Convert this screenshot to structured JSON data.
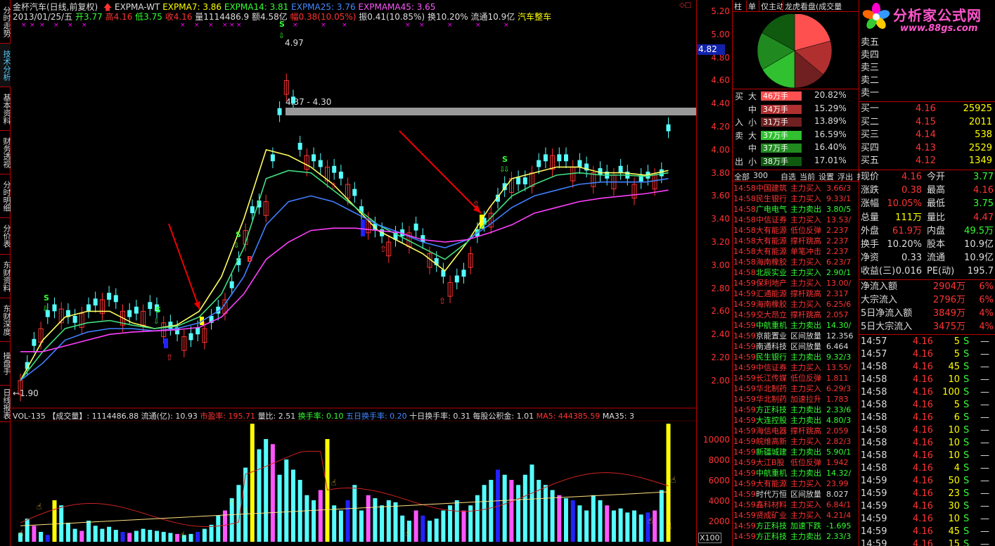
{
  "left_tabs": [
    "分时走势",
    "技术分析",
    "基本资料",
    "财务透视",
    "分时明细",
    "分价表",
    "东财资料",
    "东财深度",
    "操盘手",
    "日线报表"
  ],
  "header": {
    "title": "金杯汽车(日线,前复权)",
    "indicator_name": "EXPMA-WT",
    "expma7": "EXPMA7: 3.86",
    "expma14": "EXPMA14: 3.81",
    "expma25": "EXPMA25: 3.76",
    "expmama45": "EXPMAMA45: 3.65",
    "date": "2013/01/25/五",
    "open": "开3.77",
    "high": "高4.16",
    "low": "低3.75",
    "close": "收4.16",
    "vol": "量1114486.9",
    "amount": "额4.58亿",
    "change": "幅0.38(10.05%)",
    "amplitude": "振0.41(10.85%)",
    "turnover": "换10.20%",
    "float": "流通10.9亿",
    "sector": "汽车整车"
  },
  "price_axis": [
    "5.20",
    "5.00",
    "4.80",
    "4.60",
    "4.40",
    "4.20",
    "4.00",
    "3.80",
    "3.60",
    "3.40",
    "3.20",
    "3.00",
    "2.80",
    "2.60",
    "2.40",
    "2.20",
    "2.00"
  ],
  "price_marker": "4.82",
  "vol_axis": [
    "10000",
    "8000",
    "6000",
    "4000",
    "2000"
  ],
  "vol_unit": "X100",
  "annotations": {
    "high": "4.97",
    "range": "4.37 - 4.30",
    "low": "1.90"
  },
  "vol_header": {
    "name": "VOL-135",
    "label": "【成交量】: 1114486.88",
    "float": "流通(亿): 10.93",
    "pe": "市盈率: 195.71",
    "vr": "量比: 2.51",
    "turn": "换手率: 0.10",
    "turn5": "五日换手率: 0.20",
    "turn10": "十日换手率: 0.31",
    "fund": "每股公积金: 1.01",
    "ma5": "MA5: 444385.59",
    "ma35": "MA35: 3"
  },
  "mid_tabs": [
    "柱",
    "单",
    "仅主动",
    "龙虎看盘(成交量"
  ],
  "flow": {
    "side_labels": [
      "买",
      "入",
      "卖",
      "出"
    ],
    "rows": [
      {
        "size": "大",
        "amt": "46万手",
        "pct": "20.82%",
        "color": "#ff5050"
      },
      {
        "size": "中",
        "amt": "34万手",
        "pct": "15.29%",
        "color": "#b03030"
      },
      {
        "size": "小",
        "amt": "31万手",
        "pct": "13.89%",
        "color": "#702020"
      },
      {
        "size": "大",
        "amt": "37万手",
        "pct": "16.59%",
        "color": "#30c030"
      },
      {
        "size": "中",
        "amt": "37万手",
        "pct": "16.40%",
        "color": "#208a20"
      },
      {
        "size": "小",
        "amt": "38万手",
        "pct": "17.01%",
        "color": "#105a10"
      }
    ]
  },
  "filter_tabs": [
    "全部",
    "300",
    "自选",
    "当前",
    "设置",
    "浮出",
    "扌"
  ],
  "trades": [
    {
      "t": "14:58",
      "n": "中国建筑",
      "a": "主力买入",
      "v": "3.66/3",
      "cls": "r"
    },
    {
      "t": "14:58",
      "n": "民生银行",
      "a": "主力买入",
      "v": "9.33/1",
      "cls": "r"
    },
    {
      "t": "14:58",
      "n": "广电电气",
      "a": "主力卖出",
      "v": "3.80/5",
      "cls": "g"
    },
    {
      "t": "14:58",
      "n": "中信证券",
      "a": "主力买入",
      "v": "13.53/",
      "cls": "r"
    },
    {
      "t": "14:58",
      "n": "大有能源",
      "a": "低位反弹",
      "v": "2.237",
      "cls": "r"
    },
    {
      "t": "14:58",
      "n": "大有能源",
      "a": "撑杆跳高",
      "v": "2.237",
      "cls": "r"
    },
    {
      "t": "14:58",
      "n": "大有能源",
      "a": "单笔冲击",
      "v": "2.237",
      "cls": "r"
    },
    {
      "t": "14:58",
      "n": "海南橡胶",
      "a": "主力买入",
      "v": "6.23/7",
      "cls": "r"
    },
    {
      "t": "14:58",
      "n": "北辰实业",
      "a": "主力买入",
      "v": "2.90/1",
      "cls": "g"
    },
    {
      "t": "14:59",
      "n": "保利地产",
      "a": "主力买入",
      "v": "13.00/",
      "cls": "r"
    },
    {
      "t": "14:59",
      "n": "汇通能源",
      "a": "撑杆跳高",
      "v": "2.317",
      "cls": "r"
    },
    {
      "t": "14:59",
      "n": "海南橡胶",
      "a": "主力买入",
      "v": "6.25/6",
      "cls": "r"
    },
    {
      "t": "14:59",
      "n": "交大昂立",
      "a": "撑杆跳高",
      "v": "2.057",
      "cls": "r"
    },
    {
      "t": "14:59",
      "n": "中航重机",
      "a": "主力卖出",
      "v": "14.30/",
      "cls": "g"
    },
    {
      "t": "14:59",
      "n": "京能置业",
      "a": "区间放量",
      "v": "12.356",
      "cls": "w"
    },
    {
      "t": "14:59",
      "n": "南通科技",
      "a": "区间放量",
      "v": "6.464",
      "cls": "w"
    },
    {
      "t": "14:59",
      "n": "民生银行",
      "a": "主力卖出",
      "v": "9.32/3",
      "cls": "g"
    },
    {
      "t": "14:59",
      "n": "中信证券",
      "a": "主力买入",
      "v": "13.55/",
      "cls": "r"
    },
    {
      "t": "14:59",
      "n": "长江传媒",
      "a": "低位反弹",
      "v": "1.811",
      "cls": "r"
    },
    {
      "t": "14:59",
      "n": "华北制药",
      "a": "主力买入",
      "v": "6.29/3",
      "cls": "r"
    },
    {
      "t": "14:59",
      "n": "华北制药",
      "a": "加速拉升",
      "v": "1.783",
      "cls": "r"
    },
    {
      "t": "14:59",
      "n": "方正科技",
      "a": "主力卖出",
      "v": "2.33/6",
      "cls": "g"
    },
    {
      "t": "14:59",
      "n": "大连控股",
      "a": "主力卖出",
      "v": "4.80/3",
      "cls": "g"
    },
    {
      "t": "14:59",
      "n": "海信电器",
      "a": "撑杆跳高",
      "v": "2.059",
      "cls": "r"
    },
    {
      "t": "14:59",
      "n": "皖维高新",
      "a": "主力买入",
      "v": "2.82/3",
      "cls": "r"
    },
    {
      "t": "14:59",
      "n": "新疆城建",
      "a": "主力卖出",
      "v": "5.90/1",
      "cls": "g"
    },
    {
      "t": "14:59",
      "n": "大江B股",
      "a": "低位反弹",
      "v": "1.942",
      "cls": "r"
    },
    {
      "t": "14:59",
      "n": "中航重机",
      "a": "主力卖出",
      "v": "14.32/",
      "cls": "g"
    },
    {
      "t": "14:59",
      "n": "大有能源",
      "a": "主力买入",
      "v": "23.99",
      "cls": "r"
    },
    {
      "t": "14:59",
      "n": "时代万恒",
      "a": "区间放量",
      "v": "8.027",
      "cls": "w"
    },
    {
      "t": "14:59",
      "n": "鑫科材料",
      "a": "主力买入",
      "v": "6.84/1",
      "cls": "r"
    },
    {
      "t": "14:59",
      "n": "贤成矿业",
      "a": "主力买入",
      "v": "4.21/4",
      "cls": "r"
    },
    {
      "t": "14:59",
      "n": "方正科技",
      "a": "加速下跌",
      "v": "-1.695",
      "cls": "g"
    },
    {
      "t": "14:59",
      "n": "方正科技",
      "a": "主力卖出",
      "v": "2.33/3",
      "cls": "g"
    }
  ],
  "logo": {
    "name": "分析家公式网",
    "url": "www.88gs.com"
  },
  "sells": [
    {
      "l": "卖五"
    },
    {
      "l": "卖四"
    },
    {
      "l": "卖三"
    },
    {
      "l": "卖二"
    },
    {
      "l": "卖一"
    }
  ],
  "buys": [
    {
      "l": "买一",
      "p": "4.16",
      "v": "25925"
    },
    {
      "l": "买二",
      "p": "4.15",
      "v": "2011"
    },
    {
      "l": "买三",
      "p": "4.14",
      "v": "538"
    },
    {
      "l": "买四",
      "p": "4.13",
      "v": "2529"
    },
    {
      "l": "买五",
      "p": "4.12",
      "v": "1349"
    }
  ],
  "quote": [
    {
      "a": "现价",
      "av": "4.16",
      "ac": "r",
      "b": "今开",
      "bv": "3.77",
      "bc": "g"
    },
    {
      "a": "涨跌",
      "av": "0.38",
      "ac": "r",
      "b": "最高",
      "bv": "4.16",
      "bc": "r"
    },
    {
      "a": "涨幅",
      "av": "10.05%",
      "ac": "r",
      "b": "最低",
      "bv": "3.75",
      "bc": "g"
    },
    {
      "a": "总量",
      "av": "111万",
      "ac": "y",
      "b": "量比",
      "bv": "4.47",
      "bc": "r"
    },
    {
      "a": "外盘",
      "av": "61.9万",
      "ac": "r",
      "b": "内盘",
      "bv": "49.5万",
      "bc": "g"
    },
    {
      "a": "换手",
      "av": "10.20%",
      "ac": "w",
      "b": "股本",
      "bv": "10.9亿",
      "bc": "w"
    },
    {
      "a": "净资",
      "av": "0.33",
      "ac": "w",
      "b": "流通",
      "bv": "10.9亿",
      "bc": "w"
    },
    {
      "a": "收益(三)",
      "av": "0.016",
      "ac": "w",
      "b": "PE(动)",
      "bv": "195.7",
      "bc": "w"
    }
  ],
  "netflow": [
    {
      "l": "净流入额",
      "v": "2904万",
      "p": "6%"
    },
    {
      "l": "大宗流入",
      "v": "2796万",
      "p": "6%"
    },
    {
      "l": "5日净流入额",
      "v": "3849万",
      "p": "4%"
    },
    {
      "l": "5日大宗流入",
      "v": "3475万",
      "p": "4%"
    }
  ],
  "ticks": [
    {
      "t": "14:57",
      "p": "4.16",
      "v": "5",
      "s": "S",
      "e": "—"
    },
    {
      "t": "14:57",
      "p": "4.16",
      "v": "5",
      "s": "S",
      "e": "—"
    },
    {
      "t": "14:58",
      "p": "4.16",
      "v": "45",
      "s": "S",
      "e": "—"
    },
    {
      "t": "14:58",
      "p": "4.16",
      "v": "10",
      "s": "S",
      "e": "—"
    },
    {
      "t": "14:58",
      "p": "4.16",
      "v": "100",
      "s": "S",
      "e": "—"
    },
    {
      "t": "14:58",
      "p": "4.16",
      "v": "5",
      "s": "S",
      "e": "—"
    },
    {
      "t": "14:58",
      "p": "4.16",
      "v": "6",
      "s": "S",
      "e": "—"
    },
    {
      "t": "14:58",
      "p": "4.16",
      "v": "10",
      "s": "S",
      "e": "—"
    },
    {
      "t": "14:58",
      "p": "4.16",
      "v": "10",
      "s": "S",
      "e": "—"
    },
    {
      "t": "14:58",
      "p": "4.16",
      "v": "10",
      "s": "S",
      "e": "—"
    },
    {
      "t": "14:58",
      "p": "4.16",
      "v": "4",
      "s": "S",
      "e": "—"
    },
    {
      "t": "14:59",
      "p": "4.16",
      "v": "50",
      "s": "S",
      "e": "—"
    },
    {
      "t": "14:59",
      "p": "4.16",
      "v": "23",
      "s": "S",
      "e": "—"
    },
    {
      "t": "14:59",
      "p": "4.16",
      "v": "30",
      "s": "S",
      "e": "—"
    },
    {
      "t": "14:59",
      "p": "4.16",
      "v": "10",
      "s": "S",
      "e": "—"
    },
    {
      "t": "14:59",
      "p": "4.16",
      "v": "45",
      "s": "S",
      "e": "—"
    },
    {
      "t": "14:59",
      "p": "4.16",
      "v": "15",
      "s": "S",
      "e": "—"
    }
  ]
}
